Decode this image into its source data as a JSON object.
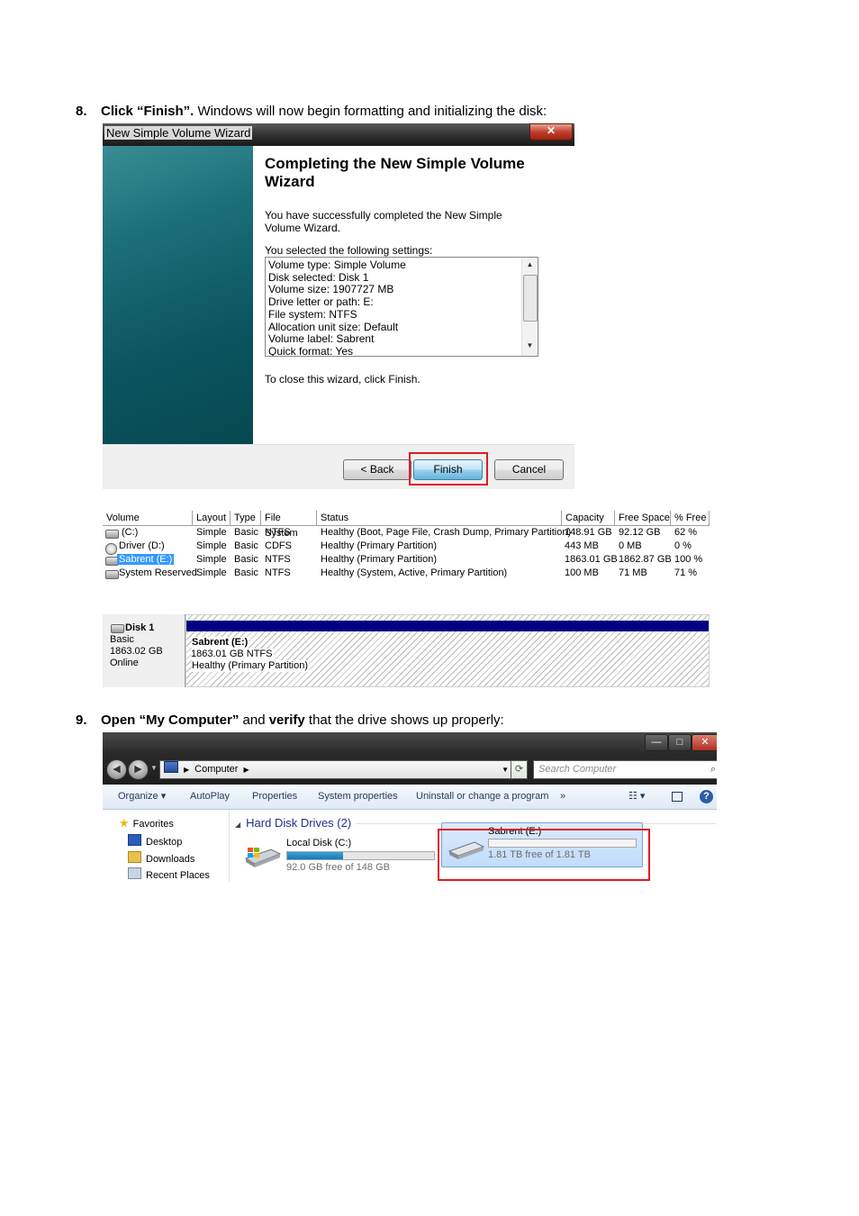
{
  "step8": {
    "number": "8.",
    "action": "Click “Finish”.",
    "rest": " Windows will now begin formatting and initializing the disk:"
  },
  "wizard": {
    "window_title": "New Simple Volume Wizard",
    "close_glyph": "✕",
    "heading": "Completing the New Simple Volume Wizard",
    "success_text": "You have successfully completed the New Simple Volume Wizard.",
    "settings_label": "You selected the following settings:",
    "settings": [
      "Volume type: Simple Volume",
      "Disk selected: Disk 1",
      "Volume size: 1907727 MB",
      "Drive letter or path: E:",
      "File system: NTFS",
      "Allocation unit size: Default",
      "Volume label: Sabrent",
      "Quick format: Yes"
    ],
    "close_text": "To close this wizard, click Finish.",
    "back_label": "< Back",
    "finish_label": "Finish",
    "cancel_label": "Cancel"
  },
  "volumes_table": {
    "headers": [
      "Volume",
      "Layout",
      "Type",
      "File System",
      "Status",
      "Capacity",
      "Free Space",
      "% Free"
    ],
    "rows": [
      [
        "(C:)",
        "Simple",
        "Basic",
        "NTFS",
        "Healthy (Boot, Page File, Crash Dump, Primary Partition)",
        "148.91 GB",
        "92.12 GB",
        "62 %"
      ],
      [
        "Driver (D:)",
        "Simple",
        "Basic",
        "CDFS",
        "Healthy (Primary Partition)",
        "443 MB",
        "0 MB",
        "0 %"
      ],
      [
        "Sabrent (E:)",
        "Simple",
        "Basic",
        "NTFS",
        "Healthy (Primary Partition)",
        "1863.01 GB",
        "1862.87 GB",
        "100 %"
      ],
      [
        "System Reserved",
        "Simple",
        "Basic",
        "NTFS",
        "Healthy (System, Active, Primary Partition)",
        "100 MB",
        "71 MB",
        "71 %"
      ]
    ]
  },
  "disk_panel": {
    "disk_name": "Disk 1",
    "disk_type": "Basic",
    "disk_size": "1863.02 GB",
    "disk_status": "Online",
    "partition_name": "Sabrent  (E:)",
    "partition_size": "1863.01 GB NTFS",
    "partition_status": "Healthy (Primary Partition)"
  },
  "step9": {
    "number": "9.",
    "action1": "Open “My Computer”",
    "mid": " and ",
    "action2": "verify",
    "rest": " that the drive shows up properly:"
  },
  "explorer": {
    "min_glyph": "—",
    "max_glyph": "□",
    "close_glyph": "✕",
    "address_path": "Computer",
    "search_placeholder": "Search Computer",
    "commands": [
      "Organize ▾",
      "AutoPlay",
      "Properties",
      "System properties",
      "Uninstall or change a program",
      "»"
    ],
    "nav": {
      "favorites": "Favorites",
      "desktop": "Desktop",
      "downloads": "Downloads",
      "recent": "Recent Places"
    },
    "group_label": "Hard Disk Drives (2)",
    "drives": [
      {
        "name": "Local Disk (C:)",
        "free": "92.0 GB free of 148 GB",
        "used_fraction": 0.38
      },
      {
        "name": "Sabrent (E:)",
        "free": "1.81 TB free of 1.81 TB",
        "used_fraction": 0.0
      }
    ]
  }
}
